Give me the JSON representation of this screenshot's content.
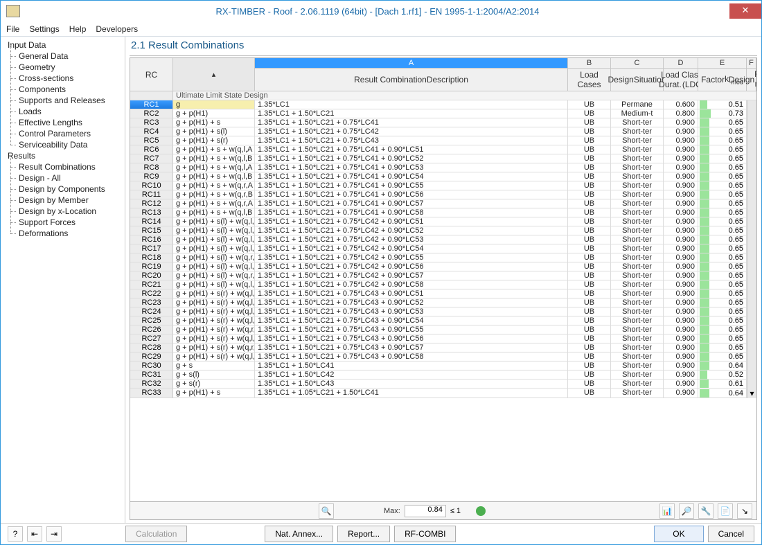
{
  "title": "RX-TIMBER - Roof - 2.06.1119 (64bit) - [Dach 1.rf1] - EN 1995-1-1:2004/A2:2014",
  "menu": [
    "File",
    "Settings",
    "Help",
    "Developers"
  ],
  "sidebar": {
    "input": "Input Data",
    "input_children": [
      "General Data",
      "Geometry",
      "Cross-sections",
      "Components",
      "Supports and Releases",
      "Loads",
      "Effective Lengths",
      "Control Parameters",
      "Serviceability Data"
    ],
    "results": "Results",
    "results_children": [
      "Result Combinations",
      "Design - All",
      "Design by Components",
      "Design by Member",
      "Design by x-Location",
      "Support Forces",
      "Deformations"
    ]
  },
  "content_title": "2.1 Result Combinations",
  "cols": {
    "letters": [
      "A",
      "B",
      "C",
      "D",
      "E",
      "F"
    ],
    "rc": "RC",
    "desc1": "Result Combination",
    "desc2": "Description",
    "loadcases": "Load Cases",
    "design1": "Design",
    "design2": "Situation",
    "ldc1": "Load Durat.",
    "ldc2": "Class (LDC",
    "factor1": "Factor",
    "factor2_html": "k <sub>mod</sub>",
    "ratio1": "Design",
    "ratio2_html": "Ratio η <sub>max</sub>"
  },
  "group": "Ultimate Limit State Design",
  "rows": [
    {
      "rc": "RC1",
      "desc": "g",
      "lc": "1.35*LC1",
      "sit": "UB",
      "ldc": "Permane",
      "k": "0.600",
      "r": 0.51
    },
    {
      "rc": "RC2",
      "desc": "g + p(H1)",
      "lc": "1.35*LC1 + 1.50*LC21",
      "sit": "UB",
      "ldc": "Medium-t",
      "k": "0.800",
      "r": 0.73
    },
    {
      "rc": "RC3",
      "desc": "g + p(H1) + s",
      "lc": "1.35*LC1 + 1.50*LC21 + 0.75*LC41",
      "sit": "UB",
      "ldc": "Short-ter",
      "k": "0.900",
      "r": 0.65
    },
    {
      "rc": "RC4",
      "desc": "g + p(H1) + s(l)",
      "lc": "1.35*LC1 + 1.50*LC21 + 0.75*LC42",
      "sit": "UB",
      "ldc": "Short-ter",
      "k": "0.900",
      "r": 0.65
    },
    {
      "rc": "RC5",
      "desc": "g + p(H1) + s(r)",
      "lc": "1.35*LC1 + 1.50*LC21 + 0.75*LC43",
      "sit": "UB",
      "ldc": "Short-ter",
      "k": "0.900",
      "r": 0.65
    },
    {
      "rc": "RC6",
      "desc": "g + p(H1) + s + w(q,l,A",
      "lc": "1.35*LC1 + 1.50*LC21 + 0.75*LC41 + 0.90*LC51",
      "sit": "UB",
      "ldc": "Short-ter",
      "k": "0.900",
      "r": 0.65
    },
    {
      "rc": "RC7",
      "desc": "g + p(H1) + s + w(q,l,B",
      "lc": "1.35*LC1 + 1.50*LC21 + 0.75*LC41 + 0.90*LC52",
      "sit": "UB",
      "ldc": "Short-ter",
      "k": "0.900",
      "r": 0.65
    },
    {
      "rc": "RC8",
      "desc": "g + p(H1) + s + w(q,l,A",
      "lc": "1.35*LC1 + 1.50*LC21 + 0.75*LC41 + 0.90*LC53",
      "sit": "UB",
      "ldc": "Short-ter",
      "k": "0.900",
      "r": 0.65
    },
    {
      "rc": "RC9",
      "desc": "g + p(H1) + s + w(q,l,B",
      "lc": "1.35*LC1 + 1.50*LC21 + 0.75*LC41 + 0.90*LC54",
      "sit": "UB",
      "ldc": "Short-ter",
      "k": "0.900",
      "r": 0.65
    },
    {
      "rc": "RC10",
      "desc": "g + p(H1) + s + w(q,r,A",
      "lc": "1.35*LC1 + 1.50*LC21 + 0.75*LC41 + 0.90*LC55",
      "sit": "UB",
      "ldc": "Short-ter",
      "k": "0.900",
      "r": 0.65
    },
    {
      "rc": "RC11",
      "desc": "g + p(H1) + s + w(q,r,B",
      "lc": "1.35*LC1 + 1.50*LC21 + 0.75*LC41 + 0.90*LC56",
      "sit": "UB",
      "ldc": "Short-ter",
      "k": "0.900",
      "r": 0.65
    },
    {
      "rc": "RC12",
      "desc": "g + p(H1) + s + w(q,r,A",
      "lc": "1.35*LC1 + 1.50*LC21 + 0.75*LC41 + 0.90*LC57",
      "sit": "UB",
      "ldc": "Short-ter",
      "k": "0.900",
      "r": 0.65
    },
    {
      "rc": "RC13",
      "desc": "g + p(H1) + s + w(q,l,B",
      "lc": "1.35*LC1 + 1.50*LC21 + 0.75*LC41 + 0.90*LC58",
      "sit": "UB",
      "ldc": "Short-ter",
      "k": "0.900",
      "r": 0.65
    },
    {
      "rc": "RC14",
      "desc": "g + p(H1) + s(l) + w(q,l,",
      "lc": "1.35*LC1 + 1.50*LC21 + 0.75*LC42 + 0.90*LC51",
      "sit": "UB",
      "ldc": "Short-ter",
      "k": "0.900",
      "r": 0.65
    },
    {
      "rc": "RC15",
      "desc": "g + p(H1) + s(l) + w(q,l,",
      "lc": "1.35*LC1 + 1.50*LC21 + 0.75*LC42 + 0.90*LC52",
      "sit": "UB",
      "ldc": "Short-ter",
      "k": "0.900",
      "r": 0.65
    },
    {
      "rc": "RC16",
      "desc": "g + p(H1) + s(l) + w(q,l,",
      "lc": "1.35*LC1 + 1.50*LC21 + 0.75*LC42 + 0.90*LC53",
      "sit": "UB",
      "ldc": "Short-ter",
      "k": "0.900",
      "r": 0.65
    },
    {
      "rc": "RC17",
      "desc": "g + p(H1) + s(l) + w(q,l,",
      "lc": "1.35*LC1 + 1.50*LC21 + 0.75*LC42 + 0.90*LC54",
      "sit": "UB",
      "ldc": "Short-ter",
      "k": "0.900",
      "r": 0.65
    },
    {
      "rc": "RC18",
      "desc": "g + p(H1) + s(l) + w(q,r,",
      "lc": "1.35*LC1 + 1.50*LC21 + 0.75*LC42 + 0.90*LC55",
      "sit": "UB",
      "ldc": "Short-ter",
      "k": "0.900",
      "r": 0.65
    },
    {
      "rc": "RC19",
      "desc": "g + p(H1) + s(l) + w(q,l,",
      "lc": "1.35*LC1 + 1.50*LC21 + 0.75*LC42 + 0.90*LC56",
      "sit": "UB",
      "ldc": "Short-ter",
      "k": "0.900",
      "r": 0.65
    },
    {
      "rc": "RC20",
      "desc": "g + p(H1) + s(l) + w(q,r,",
      "lc": "1.35*LC1 + 1.50*LC21 + 0.75*LC42 + 0.90*LC57",
      "sit": "UB",
      "ldc": "Short-ter",
      "k": "0.900",
      "r": 0.65
    },
    {
      "rc": "RC21",
      "desc": "g + p(H1) + s(l) + w(q,l,",
      "lc": "1.35*LC1 + 1.50*LC21 + 0.75*LC42 + 0.90*LC58",
      "sit": "UB",
      "ldc": "Short-ter",
      "k": "0.900",
      "r": 0.65
    },
    {
      "rc": "RC22",
      "desc": "g + p(H1) + s(r) + w(q,l,",
      "lc": "1.35*LC1 + 1.50*LC21 + 0.75*LC43 + 0.90*LC51",
      "sit": "UB",
      "ldc": "Short-ter",
      "k": "0.900",
      "r": 0.65
    },
    {
      "rc": "RC23",
      "desc": "g + p(H1) + s(r) + w(q,l,",
      "lc": "1.35*LC1 + 1.50*LC21 + 0.75*LC43 + 0.90*LC52",
      "sit": "UB",
      "ldc": "Short-ter",
      "k": "0.900",
      "r": 0.65
    },
    {
      "rc": "RC24",
      "desc": "g + p(H1) + s(r) + w(q,l,",
      "lc": "1.35*LC1 + 1.50*LC21 + 0.75*LC43 + 0.90*LC53",
      "sit": "UB",
      "ldc": "Short-ter",
      "k": "0.900",
      "r": 0.65
    },
    {
      "rc": "RC25",
      "desc": "g + p(H1) + s(r) + w(q,l,",
      "lc": "1.35*LC1 + 1.50*LC21 + 0.75*LC43 + 0.90*LC54",
      "sit": "UB",
      "ldc": "Short-ter",
      "k": "0.900",
      "r": 0.65
    },
    {
      "rc": "RC26",
      "desc": "g + p(H1) + s(r) + w(q,r,",
      "lc": "1.35*LC1 + 1.50*LC21 + 0.75*LC43 + 0.90*LC55",
      "sit": "UB",
      "ldc": "Short-ter",
      "k": "0.900",
      "r": 0.65
    },
    {
      "rc": "RC27",
      "desc": "g + p(H1) + s(r) + w(q,l,",
      "lc": "1.35*LC1 + 1.50*LC21 + 0.75*LC43 + 0.90*LC56",
      "sit": "UB",
      "ldc": "Short-ter",
      "k": "0.900",
      "r": 0.65
    },
    {
      "rc": "RC28",
      "desc": "g + p(H1) + s(r) + w(q,r,",
      "lc": "1.35*LC1 + 1.50*LC21 + 0.75*LC43 + 0.90*LC57",
      "sit": "UB",
      "ldc": "Short-ter",
      "k": "0.900",
      "r": 0.65
    },
    {
      "rc": "RC29",
      "desc": "g + p(H1) + s(r) + w(q,l,",
      "lc": "1.35*LC1 + 1.50*LC21 + 0.75*LC43 + 0.90*LC58",
      "sit": "UB",
      "ldc": "Short-ter",
      "k": "0.900",
      "r": 0.65
    },
    {
      "rc": "RC30",
      "desc": "g + s",
      "lc": "1.35*LC1 + 1.50*LC41",
      "sit": "UB",
      "ldc": "Short-ter",
      "k": "0.900",
      "r": 0.64
    },
    {
      "rc": "RC31",
      "desc": "g + s(l)",
      "lc": "1.35*LC1 + 1.50*LC42",
      "sit": "UB",
      "ldc": "Short-ter",
      "k": "0.900",
      "r": 0.52
    },
    {
      "rc": "RC32",
      "desc": "g + s(r)",
      "lc": "1.35*LC1 + 1.50*LC43",
      "sit": "UB",
      "ldc": "Short-ter",
      "k": "0.900",
      "r": 0.61
    },
    {
      "rc": "RC33",
      "desc": "g + p(H1) + s",
      "lc": "1.35*LC1 + 1.05*LC21 + 1.50*LC41",
      "sit": "UB",
      "ldc": "Short-ter",
      "k": "0.900",
      "r": 0.64
    }
  ],
  "toolbar": {
    "max_label": "Max:",
    "max_value": "0.84",
    "limit": "≤ 1"
  },
  "footer": {
    "calculation": "Calculation",
    "natannex": "Nat. Annex...",
    "report": "Report...",
    "rfcombi": "RF-COMBI",
    "ok": "OK",
    "cancel": "Cancel"
  }
}
